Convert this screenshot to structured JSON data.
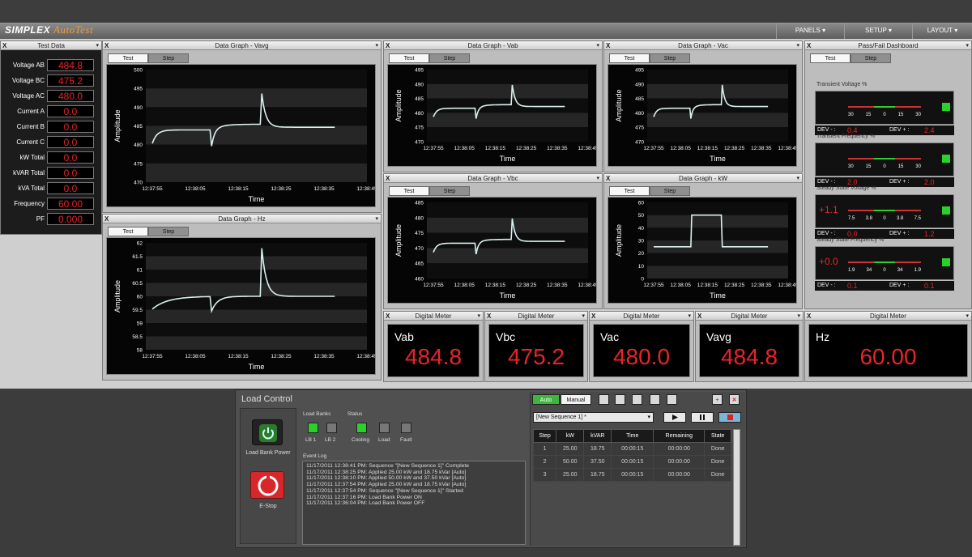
{
  "app": {
    "brand": "SIMPLEX",
    "product": "AutoTest"
  },
  "menu": {
    "panels": "PANELS ▾",
    "setup": "SETUP ▾",
    "layout": "LAYOUT ▾"
  },
  "common": {
    "close": "X",
    "dropdown": "▾",
    "tab_test": "Test",
    "tab_step": "Step",
    "amplitude": "Amplitude",
    "time": "Time"
  },
  "test_data": {
    "title": "Test Data",
    "rows": [
      {
        "label": "Voltage AB",
        "value": "484.8"
      },
      {
        "label": "Voltage BC",
        "value": "475.2"
      },
      {
        "label": "Voltage AC",
        "value": "480.0"
      },
      {
        "label": "Current A",
        "value": "0.0"
      },
      {
        "label": "Current B",
        "value": "0.0"
      },
      {
        "label": "Current C",
        "value": "0.0"
      },
      {
        "label": "kW Total",
        "value": "0.0"
      },
      {
        "label": "kVAR Total",
        "value": "0.0"
      },
      {
        "label": "kVA Total",
        "value": "0.0"
      },
      {
        "label": "Frequency",
        "value": "60.00"
      },
      {
        "label": "PF",
        "value": "0.000"
      }
    ]
  },
  "graphs": {
    "vavg": {
      "title": "Data Graph - Vavg",
      "y_ticks": [
        "500",
        "495",
        "490",
        "485",
        "480",
        "475",
        "470"
      ],
      "x_ticks": [
        "12:37:55",
        "12:38:05",
        "12:38:15",
        "12:38:25",
        "12:38:35",
        "12:38:45"
      ],
      "ylim": [
        470,
        500
      ]
    },
    "hz": {
      "title": "Data Graph - Hz",
      "y_ticks": [
        "62",
        "61.5",
        "61",
        "60.5",
        "60",
        "59.5",
        "59",
        "58.5",
        "58"
      ],
      "x_ticks": [
        "12:37:55",
        "12:38:05",
        "12:38:15",
        "12:38:25",
        "12:38:35",
        "12:38:45"
      ],
      "ylim": [
        58,
        62
      ]
    },
    "vab": {
      "title": "Data Graph - Vab",
      "y_ticks": [
        "495",
        "490",
        "485",
        "480",
        "475",
        "470"
      ],
      "x_ticks": [
        "12:37:55",
        "12:38:05",
        "12:38:15",
        "12:38:25",
        "12:38:35",
        "12:38:45"
      ],
      "ylim": [
        470,
        495
      ]
    },
    "vac": {
      "title": "Data Graph - Vac",
      "y_ticks": [
        "495",
        "490",
        "485",
        "480",
        "475",
        "470"
      ],
      "x_ticks": [
        "12:37:55",
        "12:38:05",
        "12:38:15",
        "12:38:25",
        "12:38:35",
        "12:38:45"
      ],
      "ylim": [
        470,
        495
      ]
    },
    "vbc": {
      "title": "Data Graph - Vbc",
      "y_ticks": [
        "485",
        "480",
        "475",
        "470",
        "465",
        "460"
      ],
      "x_ticks": [
        "12:37:55",
        "12:38:05",
        "12:38:15",
        "12:38:25",
        "12:38:35",
        "12:38:45"
      ],
      "ylim": [
        460,
        485
      ]
    },
    "kw": {
      "title": "Data Graph - kW",
      "y_ticks": [
        "60",
        "50",
        "40",
        "30",
        "20",
        "10",
        "0"
      ],
      "x_ticks": [
        "12:37:55",
        "12:38:05",
        "12:38:15",
        "12:38:25",
        "12:38:35",
        "12:38:45"
      ],
      "ylim": [
        0,
        60
      ]
    }
  },
  "pass_fail": {
    "title": "Pass/Fail Dashboard",
    "sections": [
      {
        "title": "Transient Voltage %",
        "value": "",
        "scale": [
          "30",
          "15",
          "0",
          "15",
          "30"
        ],
        "dev_minus_label": "DEV - :",
        "dev_minus": "0.4",
        "dev_plus_label": "DEV + :",
        "dev_plus": "2.4"
      },
      {
        "title": "Transient Frequency %",
        "value": "",
        "scale": [
          "30",
          "15",
          "0",
          "15",
          "30"
        ],
        "dev_minus_label": "DEV - :",
        "dev_minus": "2.0",
        "dev_plus_label": "DEV + :",
        "dev_plus": "2.0"
      },
      {
        "title": "Steady State Voltage %",
        "value": "+1.1",
        "scale": [
          "7.5",
          "3.8",
          "0",
          "3.8",
          "7.5"
        ],
        "dev_minus_label": "DEV - :",
        "dev_minus": "0.0",
        "dev_plus_label": "DEV + :",
        "dev_plus": "1.2"
      },
      {
        "title": "Steady State Frequency %",
        "value": "+0.0",
        "scale": [
          "1.9",
          "34",
          "0",
          "34",
          "1.9"
        ],
        "dev_minus_label": "DEV - :",
        "dev_minus": "0.1",
        "dev_plus_label": "DEV + :",
        "dev_plus": "0.1"
      }
    ]
  },
  "digital_meters": [
    {
      "title": "Digital Meter",
      "label": "Vab",
      "value": "484.8"
    },
    {
      "title": "Digital Meter",
      "label": "Vbc",
      "value": "475.2"
    },
    {
      "title": "Digital Meter",
      "label": "Vac",
      "value": "480.0"
    },
    {
      "title": "Digital Meter",
      "label": "Vavg",
      "value": "484.8"
    },
    {
      "title": "Digital Meter",
      "label": "Hz",
      "value": "60.00"
    }
  ],
  "load_control": {
    "title": "Load Control",
    "load_bank_power": "Load Bank Power",
    "estop": "E-Stop",
    "load_banks_label": "Load Banks",
    "lb1": "LB 1",
    "lb2": "LB 2",
    "status_label": "Status",
    "cooling": "Cooling",
    "load": "Load",
    "fault": "Fault",
    "event_log_label": "Event Log",
    "event_log": [
      "11/17/2011 12:38:41 PM: Sequence \"[New Sequence 1]\" Complete",
      "11/17/2011 12:38:25 PM: Applied 25.00 kW and 18.75 kVar [Auto]",
      "11/17/2011 12:38:10 PM: Applied 50.00 kW and 37.50 kVar [Auto]",
      "11/17/2011 12:37:54 PM: Applied 25.00 kW and 18.75 kVar [Auto]",
      "11/17/2011 12:37:54 PM: Sequence \"[New Sequence 1]\" Started",
      "11/17/2011 12:37:16 PM: Load Bank Power ON",
      "11/17/2011 12:36:04 PM: Load Bank Power OFF"
    ],
    "mode_auto": "Auto",
    "mode_manual": "Manual",
    "sequence_select": "[New Sequence 1] *",
    "table_headers": [
      "Step",
      "kW",
      "kVAR",
      "Time",
      "Remaining",
      "State"
    ],
    "table_rows": [
      [
        "1",
        "25.00",
        "18.75",
        "00:00:15",
        "00:00:00",
        "Done"
      ],
      [
        "2",
        "50.00",
        "37.50",
        "00:00:15",
        "00:00:00",
        "Done"
      ],
      [
        "3",
        "25.00",
        "18.75",
        "00:00:15",
        "00:00:00",
        "Done"
      ]
    ]
  },
  "colors": {
    "accent_red": "#e8242a",
    "accent_green": "#2bd12b",
    "trace": "#d9f0ee"
  }
}
